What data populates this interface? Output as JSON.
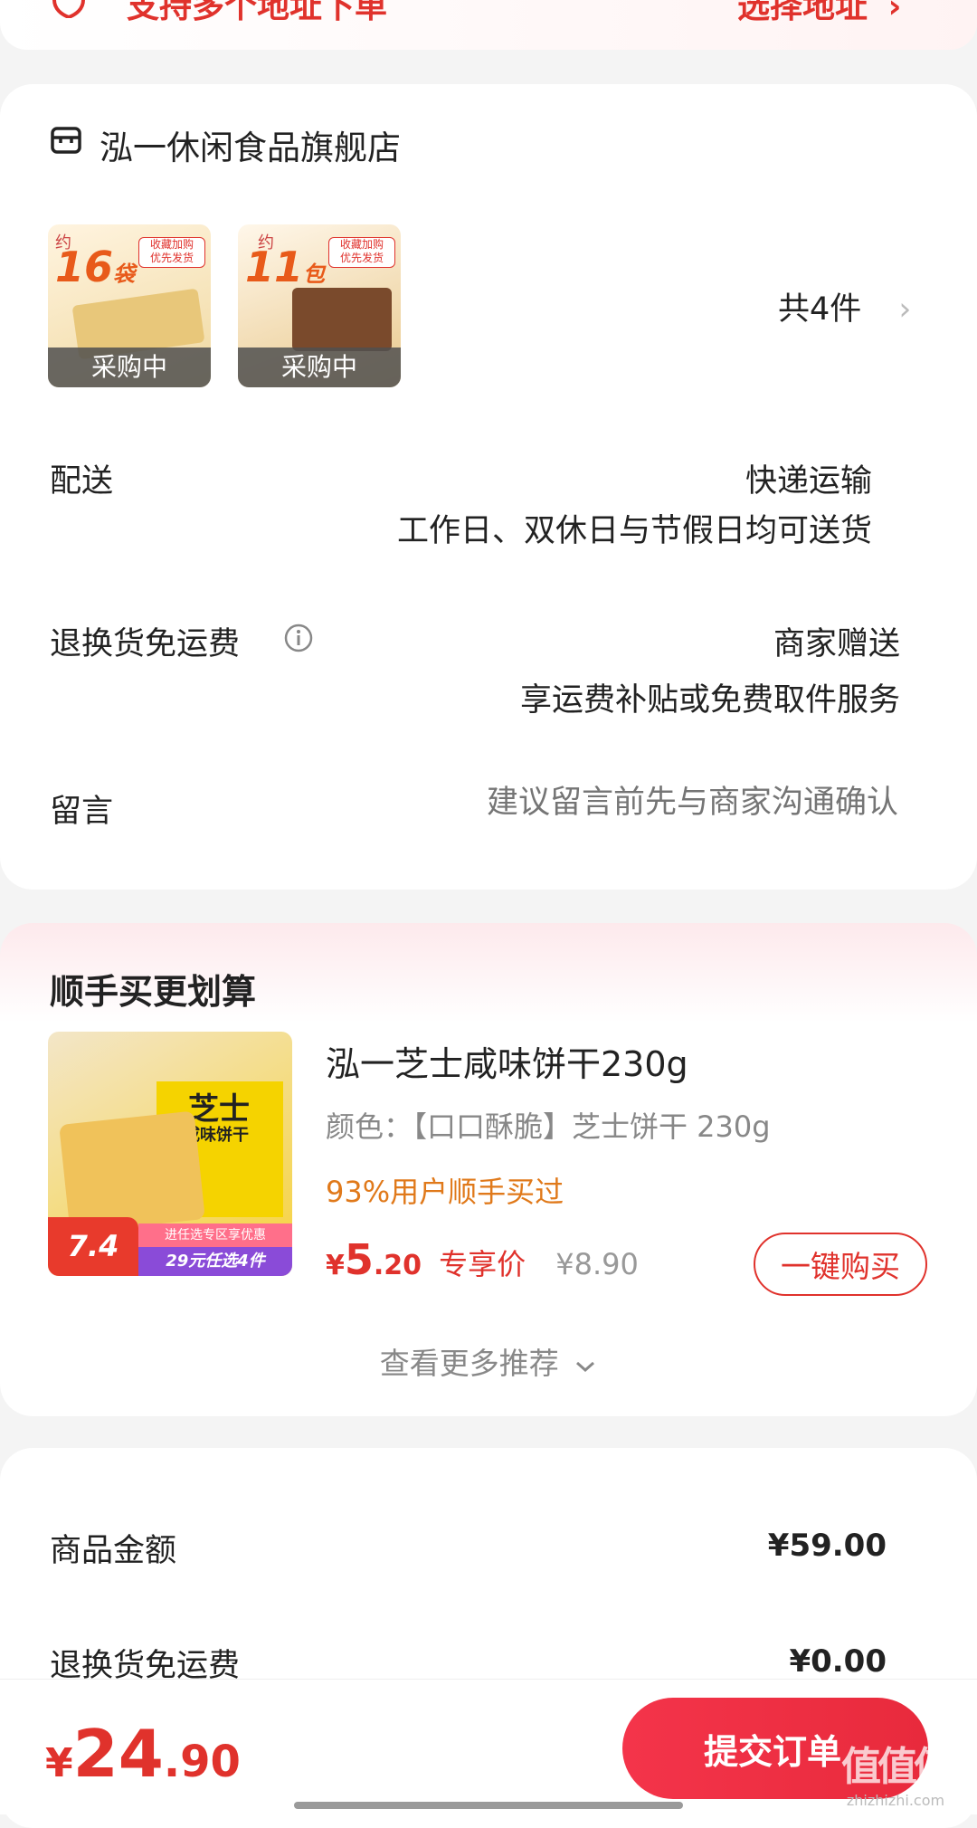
{
  "address_banner": {
    "left_text": "支持多个地址下单",
    "right_text": "选择地址",
    "right_chevron": "›"
  },
  "store": {
    "name": "泓一休闲食品旗舰店",
    "icon": "store-icon",
    "thumbs": [
      {
        "badge_number": "16",
        "badge_unit": "袋",
        "badge_top": "约",
        "corner": "收藏加购\n优先发货",
        "caption": "采购中"
      },
      {
        "badge_number": "11",
        "badge_unit": "包",
        "badge_top": "约",
        "corner": "收藏加购\n优先发货",
        "caption": "采购中"
      }
    ],
    "count_label": "共4件",
    "count_chevron": "›"
  },
  "delivery": {
    "label": "配送",
    "method": "快递运输",
    "note": "工作日、双休日与节假日均可送货"
  },
  "returns": {
    "label": "退换货免运费",
    "info_icon": "info-icon",
    "value": "商家赠送",
    "note": "享运费补贴或免费取件服务"
  },
  "message": {
    "label": "留言",
    "placeholder": "建议留言前先与商家沟通确认"
  },
  "recommend": {
    "title": "顺手买更划算",
    "product": {
      "name": "泓一芝士咸味饼干230g",
      "spec": "颜色：【口口酥脆】芝士饼干 230g",
      "social": "93%用户顺手买过",
      "price_symbol": "¥",
      "price_int": "5",
      "price_dec": ".20",
      "price_tag": "专享价",
      "original_price": "¥8.90",
      "buy_label": "一键购买",
      "img_title": "芝士",
      "img_sub": "咸味饼干",
      "img_price": "7.4",
      "img_promo1": "进任选专区享优惠",
      "img_promo2": "29元任选4件"
    },
    "more_label": "查看更多推荐",
    "more_icon": "chevron-down-icon"
  },
  "summary": {
    "rows": [
      {
        "label": "商品金额",
        "value": "¥59.00"
      },
      {
        "label": "退换货免运费",
        "value": "¥0.00"
      }
    ]
  },
  "footer": {
    "total_symbol": "¥",
    "total_int": "24",
    "total_dec": ".90",
    "submit_label": "提交订单",
    "watermark": "值值值",
    "watermark_url": "zhizhizhi.com"
  },
  "colors": {
    "accent": "#e0322c",
    "price": "#e0322c",
    "social": "#e0791a",
    "muted": "#999999"
  }
}
